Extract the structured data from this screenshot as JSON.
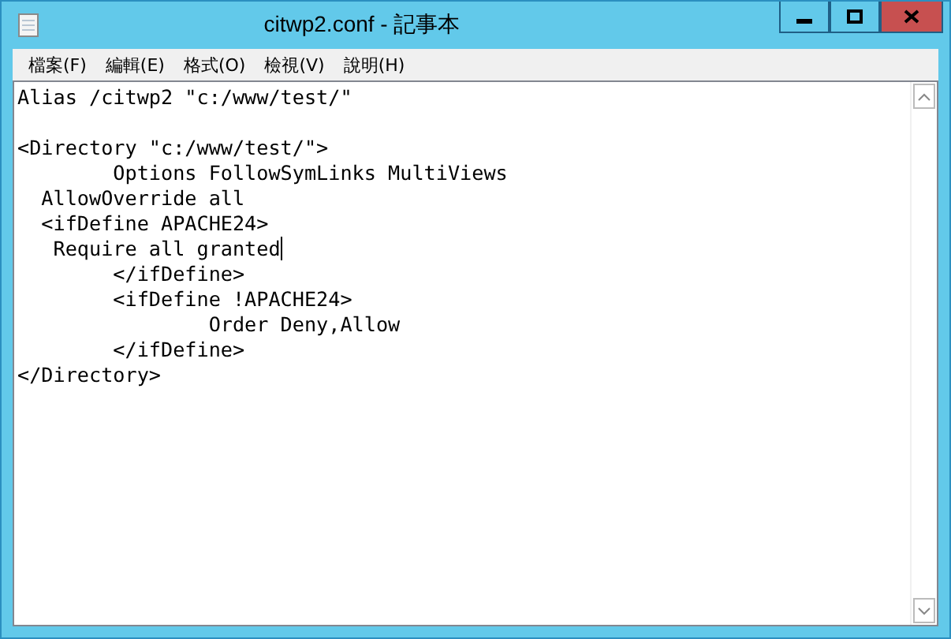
{
  "window": {
    "title": "citwp2.conf - 記事本"
  },
  "menu": [
    {
      "label": "檔案(F)"
    },
    {
      "label": "編輯(E)"
    },
    {
      "label": "格式(O)"
    },
    {
      "label": "檢視(V)"
    },
    {
      "label": "說明(H)"
    }
  ],
  "editor": {
    "lines": [
      {
        "text": "Alias /citwp2 \"c:/www/test/\"",
        "cursor": false
      },
      {
        "cursor": false
      },
      {
        "text": "<Directory \"c:/www/test/\">",
        "cursor": false
      },
      {
        "text": "        Options FollowSymLinks MultiViews",
        "cursor": false
      },
      {
        "text": "  AllowOverride all",
        "cursor": false
      },
      {
        "text": "  <ifDefine APACHE24>",
        "cursor": false
      },
      {
        "text": "   Require all granted",
        "cursor": true
      },
      {
        "text": "        </ifDefine>",
        "cursor": false
      },
      {
        "text": "        <ifDefine !APACHE24>",
        "cursor": false
      },
      {
        "text": "                Order Deny,Allow",
        "cursor": false
      },
      {
        "text": "        </ifDefine>",
        "cursor": false
      },
      {
        "text": "</Directory>",
        "cursor": false
      }
    ]
  }
}
